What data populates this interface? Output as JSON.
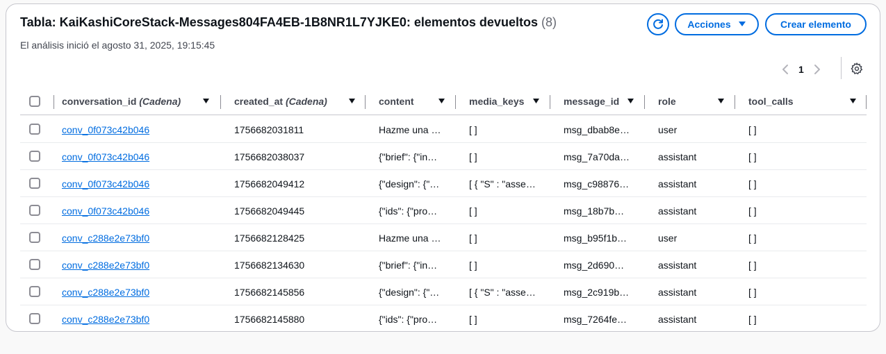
{
  "header": {
    "title": "Tabla: KaiKashiCoreStack-Messages804FA4EB-1B8NR1L7YJKE0: elementos devueltos",
    "count": "(8)",
    "subtitle": "El análisis inició el agosto 31, 2025, 19:15:45",
    "actions_label": "Acciones",
    "create_label": "Crear elemento"
  },
  "pagination": {
    "current_page": "1"
  },
  "table": {
    "columns": [
      {
        "name": "conversation_id",
        "type": "(Cadena)"
      },
      {
        "name": "created_at",
        "type": "(Cadena)"
      },
      {
        "name": "content",
        "type": ""
      },
      {
        "name": "media_keys",
        "type": ""
      },
      {
        "name": "message_id",
        "type": ""
      },
      {
        "name": "role",
        "type": ""
      },
      {
        "name": "tool_calls",
        "type": ""
      }
    ],
    "rows": [
      {
        "conversation_id": "conv_0f073c42b046",
        "created_at": "1756682031811",
        "content": "Hazme una …",
        "media_keys": "[ ]",
        "message_id": "msg_dbab8e…",
        "role": "user",
        "tool_calls": "[ ]"
      },
      {
        "conversation_id": "conv_0f073c42b046",
        "created_at": "1756682038037",
        "content": "{\"brief\": {\"in…",
        "media_keys": "[ ]",
        "message_id": "msg_7a70da…",
        "role": "assistant",
        "tool_calls": "[ ]"
      },
      {
        "conversation_id": "conv_0f073c42b046",
        "created_at": "1756682049412",
        "content": "{\"design\": {\"…",
        "media_keys": "[ { \"S\" : \"asse…",
        "message_id": "msg_c98876…",
        "role": "assistant",
        "tool_calls": "[ ]"
      },
      {
        "conversation_id": "conv_0f073c42b046",
        "created_at": "1756682049445",
        "content": "{\"ids\": {\"pro…",
        "media_keys": "[ ]",
        "message_id": "msg_18b7b…",
        "role": "assistant",
        "tool_calls": "[ ]"
      },
      {
        "conversation_id": "conv_c288e2e73bf0",
        "created_at": "1756682128425",
        "content": "Hazme una …",
        "media_keys": "[ ]",
        "message_id": "msg_b95f1b…",
        "role": "user",
        "tool_calls": "[ ]"
      },
      {
        "conversation_id": "conv_c288e2e73bf0",
        "created_at": "1756682134630",
        "content": "{\"brief\": {\"in…",
        "media_keys": "[ ]",
        "message_id": "msg_2d690…",
        "role": "assistant",
        "tool_calls": "[ ]"
      },
      {
        "conversation_id": "conv_c288e2e73bf0",
        "created_at": "1756682145856",
        "content": "{\"design\": {\"…",
        "media_keys": "[ { \"S\" : \"asse…",
        "message_id": "msg_2c919b…",
        "role": "assistant",
        "tool_calls": "[ ]"
      },
      {
        "conversation_id": "conv_c288e2e73bf0",
        "created_at": "1756682145880",
        "content": "{\"ids\": {\"pro…",
        "media_keys": "[ ]",
        "message_id": "msg_7264fe…",
        "role": "assistant",
        "tool_calls": "[ ]"
      }
    ]
  },
  "colors": {
    "accent": "#006ce0",
    "border": "#c6c6cd",
    "text": "#0f141a",
    "muted": "#656871"
  },
  "icons": {
    "refresh": "refresh-icon",
    "dropdown": "caret-down-icon",
    "prev": "chevron-left-icon",
    "next": "chevron-right-icon",
    "settings": "gear-icon",
    "sort": "sort-caret-icon"
  }
}
